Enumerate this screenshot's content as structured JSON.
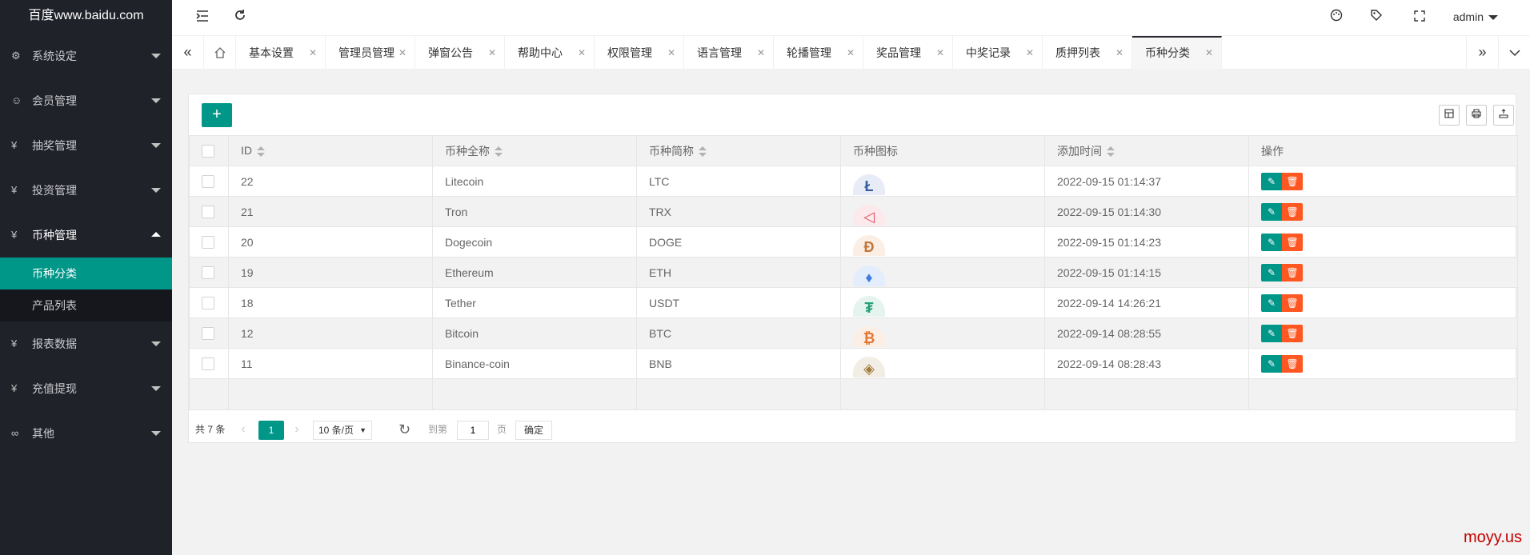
{
  "logo": "百度www.baidu.com",
  "sidebar": {
    "items": [
      {
        "label": "系统设定",
        "icon": "gear-icon"
      },
      {
        "label": "会员管理",
        "icon": "user-icon"
      },
      {
        "label": "抽奖管理",
        "icon": "yen-icon"
      },
      {
        "label": "投资管理",
        "icon": "yen-icon"
      },
      {
        "label": "币种管理",
        "icon": "yen-icon"
      },
      {
        "label": "报表数据",
        "icon": "yen-icon"
      },
      {
        "label": "充值提现",
        "icon": "yen-icon"
      },
      {
        "label": "其他",
        "icon": "link-icon"
      }
    ],
    "sub_items": [
      "币种分类",
      "产品列表"
    ]
  },
  "header": {
    "user": "admin"
  },
  "tabs": [
    "基本设置",
    "管理员管理",
    "弹窗公告",
    "帮助中心",
    "权限管理",
    "语言管理",
    "轮播管理",
    "奖品管理",
    "中奖记录",
    "质押列表",
    "币种分类"
  ],
  "table": {
    "headers": [
      "ID",
      "币种全称",
      "币种简称",
      "币种图标",
      "添加时间",
      "操作"
    ],
    "rows": [
      {
        "id": "22",
        "name": "Litecoin",
        "symbol": "LTC",
        "time": "2022-09-15 01:14:37",
        "icon_color": "#345d9d",
        "icon_bg": "#e8ecf6",
        "glyph": "Ł"
      },
      {
        "id": "21",
        "name": "Tron",
        "symbol": "TRX",
        "time": "2022-09-15 01:14:30",
        "icon_color": "#e0495d",
        "icon_bg": "#fbe9eb",
        "glyph": "◁"
      },
      {
        "id": "20",
        "name": "Dogecoin",
        "symbol": "DOGE",
        "time": "2022-09-15 01:14:23",
        "icon_color": "#c2763a",
        "icon_bg": "#fbeee4",
        "glyph": "Ð"
      },
      {
        "id": "19",
        "name": "Ethereum",
        "symbol": "ETH",
        "time": "2022-09-15 01:14:15",
        "icon_color": "#3f7be0",
        "icon_bg": "#e4edfb",
        "glyph": "♦"
      },
      {
        "id": "18",
        "name": "Tether",
        "symbol": "USDT",
        "time": "2022-09-14 14:26:21",
        "icon_color": "#26a17b",
        "icon_bg": "#e5f4ee",
        "glyph": "₮"
      },
      {
        "id": "12",
        "name": "Bitcoin",
        "symbol": "BTC",
        "time": "2022-09-14 08:28:55",
        "icon_color": "#e27634",
        "icon_bg": "#fbeee4",
        "glyph": "₿"
      },
      {
        "id": "11",
        "name": "Binance-coin",
        "symbol": "BNB",
        "time": "2022-09-14 08:28:43",
        "icon_color": "#a07a3c",
        "icon_bg": "#f2eee6",
        "glyph": "◈"
      }
    ]
  },
  "pager": {
    "total": "共 7 条",
    "current": "1",
    "size": "10 条/页",
    "goto": "到第",
    "input": "1",
    "page": "页",
    "ok": "确定"
  },
  "watermark": "moyy.us",
  "colors": {
    "accent": "#009688",
    "danger": "#FF5722",
    "sidebar": "#20222a"
  }
}
